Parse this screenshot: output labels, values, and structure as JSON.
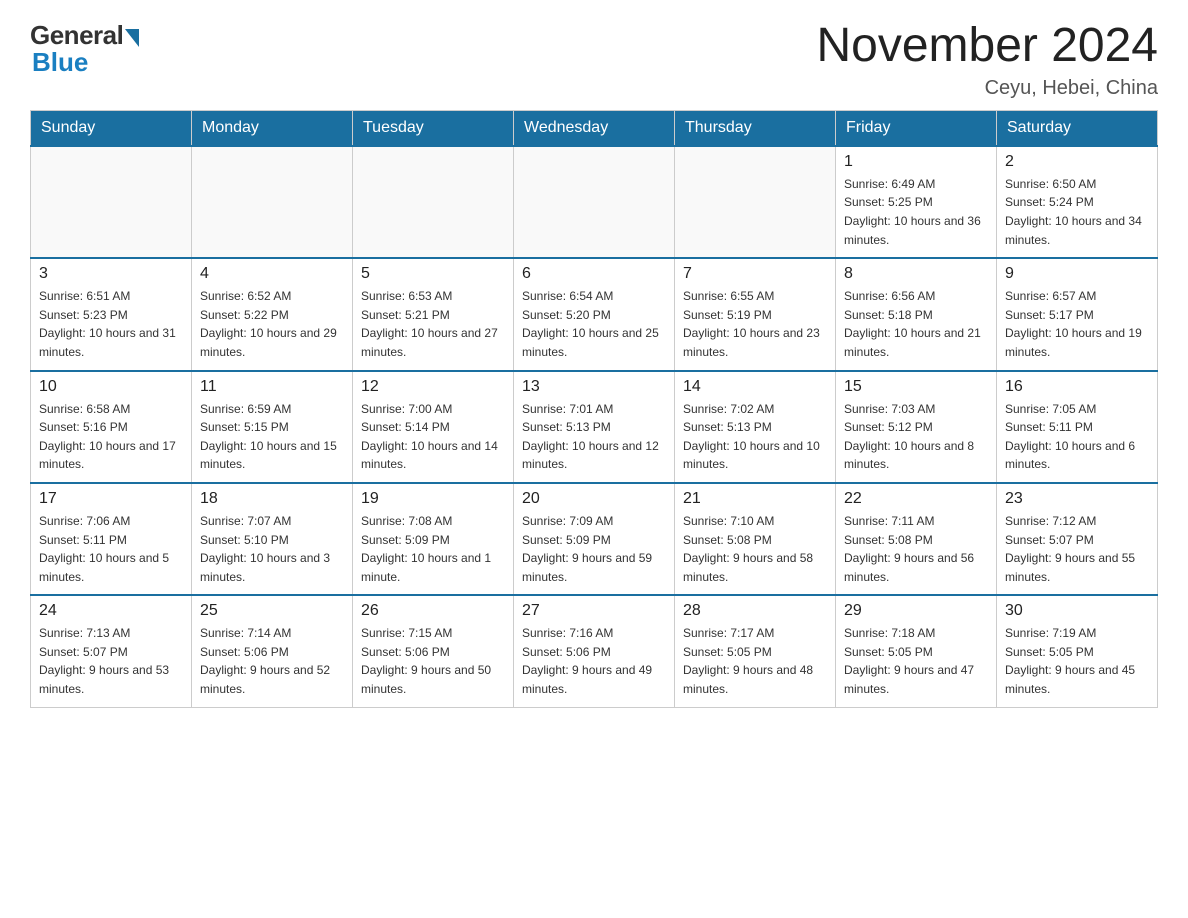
{
  "logo": {
    "general": "General",
    "blue": "Blue"
  },
  "header": {
    "title": "November 2024",
    "location": "Ceyu, Hebei, China"
  },
  "weekdays": [
    "Sunday",
    "Monday",
    "Tuesday",
    "Wednesday",
    "Thursday",
    "Friday",
    "Saturday"
  ],
  "weeks": [
    [
      {
        "day": "",
        "info": ""
      },
      {
        "day": "",
        "info": ""
      },
      {
        "day": "",
        "info": ""
      },
      {
        "day": "",
        "info": ""
      },
      {
        "day": "",
        "info": ""
      },
      {
        "day": "1",
        "info": "Sunrise: 6:49 AM\nSunset: 5:25 PM\nDaylight: 10 hours and 36 minutes."
      },
      {
        "day": "2",
        "info": "Sunrise: 6:50 AM\nSunset: 5:24 PM\nDaylight: 10 hours and 34 minutes."
      }
    ],
    [
      {
        "day": "3",
        "info": "Sunrise: 6:51 AM\nSunset: 5:23 PM\nDaylight: 10 hours and 31 minutes."
      },
      {
        "day": "4",
        "info": "Sunrise: 6:52 AM\nSunset: 5:22 PM\nDaylight: 10 hours and 29 minutes."
      },
      {
        "day": "5",
        "info": "Sunrise: 6:53 AM\nSunset: 5:21 PM\nDaylight: 10 hours and 27 minutes."
      },
      {
        "day": "6",
        "info": "Sunrise: 6:54 AM\nSunset: 5:20 PM\nDaylight: 10 hours and 25 minutes."
      },
      {
        "day": "7",
        "info": "Sunrise: 6:55 AM\nSunset: 5:19 PM\nDaylight: 10 hours and 23 minutes."
      },
      {
        "day": "8",
        "info": "Sunrise: 6:56 AM\nSunset: 5:18 PM\nDaylight: 10 hours and 21 minutes."
      },
      {
        "day": "9",
        "info": "Sunrise: 6:57 AM\nSunset: 5:17 PM\nDaylight: 10 hours and 19 minutes."
      }
    ],
    [
      {
        "day": "10",
        "info": "Sunrise: 6:58 AM\nSunset: 5:16 PM\nDaylight: 10 hours and 17 minutes."
      },
      {
        "day": "11",
        "info": "Sunrise: 6:59 AM\nSunset: 5:15 PM\nDaylight: 10 hours and 15 minutes."
      },
      {
        "day": "12",
        "info": "Sunrise: 7:00 AM\nSunset: 5:14 PM\nDaylight: 10 hours and 14 minutes."
      },
      {
        "day": "13",
        "info": "Sunrise: 7:01 AM\nSunset: 5:13 PM\nDaylight: 10 hours and 12 minutes."
      },
      {
        "day": "14",
        "info": "Sunrise: 7:02 AM\nSunset: 5:13 PM\nDaylight: 10 hours and 10 minutes."
      },
      {
        "day": "15",
        "info": "Sunrise: 7:03 AM\nSunset: 5:12 PM\nDaylight: 10 hours and 8 minutes."
      },
      {
        "day": "16",
        "info": "Sunrise: 7:05 AM\nSunset: 5:11 PM\nDaylight: 10 hours and 6 minutes."
      }
    ],
    [
      {
        "day": "17",
        "info": "Sunrise: 7:06 AM\nSunset: 5:11 PM\nDaylight: 10 hours and 5 minutes."
      },
      {
        "day": "18",
        "info": "Sunrise: 7:07 AM\nSunset: 5:10 PM\nDaylight: 10 hours and 3 minutes."
      },
      {
        "day": "19",
        "info": "Sunrise: 7:08 AM\nSunset: 5:09 PM\nDaylight: 10 hours and 1 minute."
      },
      {
        "day": "20",
        "info": "Sunrise: 7:09 AM\nSunset: 5:09 PM\nDaylight: 9 hours and 59 minutes."
      },
      {
        "day": "21",
        "info": "Sunrise: 7:10 AM\nSunset: 5:08 PM\nDaylight: 9 hours and 58 minutes."
      },
      {
        "day": "22",
        "info": "Sunrise: 7:11 AM\nSunset: 5:08 PM\nDaylight: 9 hours and 56 minutes."
      },
      {
        "day": "23",
        "info": "Sunrise: 7:12 AM\nSunset: 5:07 PM\nDaylight: 9 hours and 55 minutes."
      }
    ],
    [
      {
        "day": "24",
        "info": "Sunrise: 7:13 AM\nSunset: 5:07 PM\nDaylight: 9 hours and 53 minutes."
      },
      {
        "day": "25",
        "info": "Sunrise: 7:14 AM\nSunset: 5:06 PM\nDaylight: 9 hours and 52 minutes."
      },
      {
        "day": "26",
        "info": "Sunrise: 7:15 AM\nSunset: 5:06 PM\nDaylight: 9 hours and 50 minutes."
      },
      {
        "day": "27",
        "info": "Sunrise: 7:16 AM\nSunset: 5:06 PM\nDaylight: 9 hours and 49 minutes."
      },
      {
        "day": "28",
        "info": "Sunrise: 7:17 AM\nSunset: 5:05 PM\nDaylight: 9 hours and 48 minutes."
      },
      {
        "day": "29",
        "info": "Sunrise: 7:18 AM\nSunset: 5:05 PM\nDaylight: 9 hours and 47 minutes."
      },
      {
        "day": "30",
        "info": "Sunrise: 7:19 AM\nSunset: 5:05 PM\nDaylight: 9 hours and 45 minutes."
      }
    ]
  ]
}
